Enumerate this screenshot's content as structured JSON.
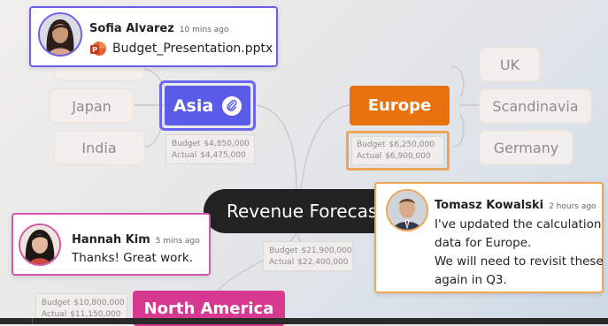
{
  "mindmap": {
    "center": "Revenue Forecast",
    "asia": {
      "label": "Asia",
      "budget_label": "Budget",
      "budget_value": "$4,850,000",
      "actual_label": "Actual",
      "actual_value": "$4,475,000",
      "children": [
        "Japan",
        "India"
      ]
    },
    "europe": {
      "label": "Europe",
      "budget_label": "Budget",
      "budget_value": "$6,250,000",
      "actual_label": "Actual",
      "actual_value": "$6,900,000",
      "children": [
        "UK",
        "Scandinavia",
        "Germany"
      ]
    },
    "total": {
      "budget_label": "Budget",
      "budget_value": "$21,900,000",
      "actual_label": "Actual",
      "actual_value": "$22,400,000"
    },
    "north_america": {
      "label": "North America",
      "budget_label": "Budget",
      "budget_value": "$10,800,000",
      "actual_label": "Actual",
      "actual_value": "$11,150,000"
    }
  },
  "comments": {
    "sofia": {
      "name": "Sofia Alvarez",
      "time": "10 mins ago",
      "attachment": "Budget_Presentation.pptx",
      "attachment_icon": "powerpoint-icon"
    },
    "hannah": {
      "name": "Hannah Kim",
      "time": "5 mins ago",
      "text": "Thanks! Great work."
    },
    "tomasz": {
      "name": "Tomasz Kowalski",
      "time": "2 hours ago",
      "lines": [
        "I've updated the calculation",
        "data for Europe.",
        "We will need to revisit these",
        "again in Q3."
      ]
    }
  },
  "colors": {
    "asia": "#5a5ce8",
    "europe": "#e8730e",
    "north_america": "#d6398f",
    "center": "#222222",
    "sofia_border": "#6b5ee8",
    "hannah_border": "#d35aa8",
    "tomasz_border": "#f0a458"
  }
}
